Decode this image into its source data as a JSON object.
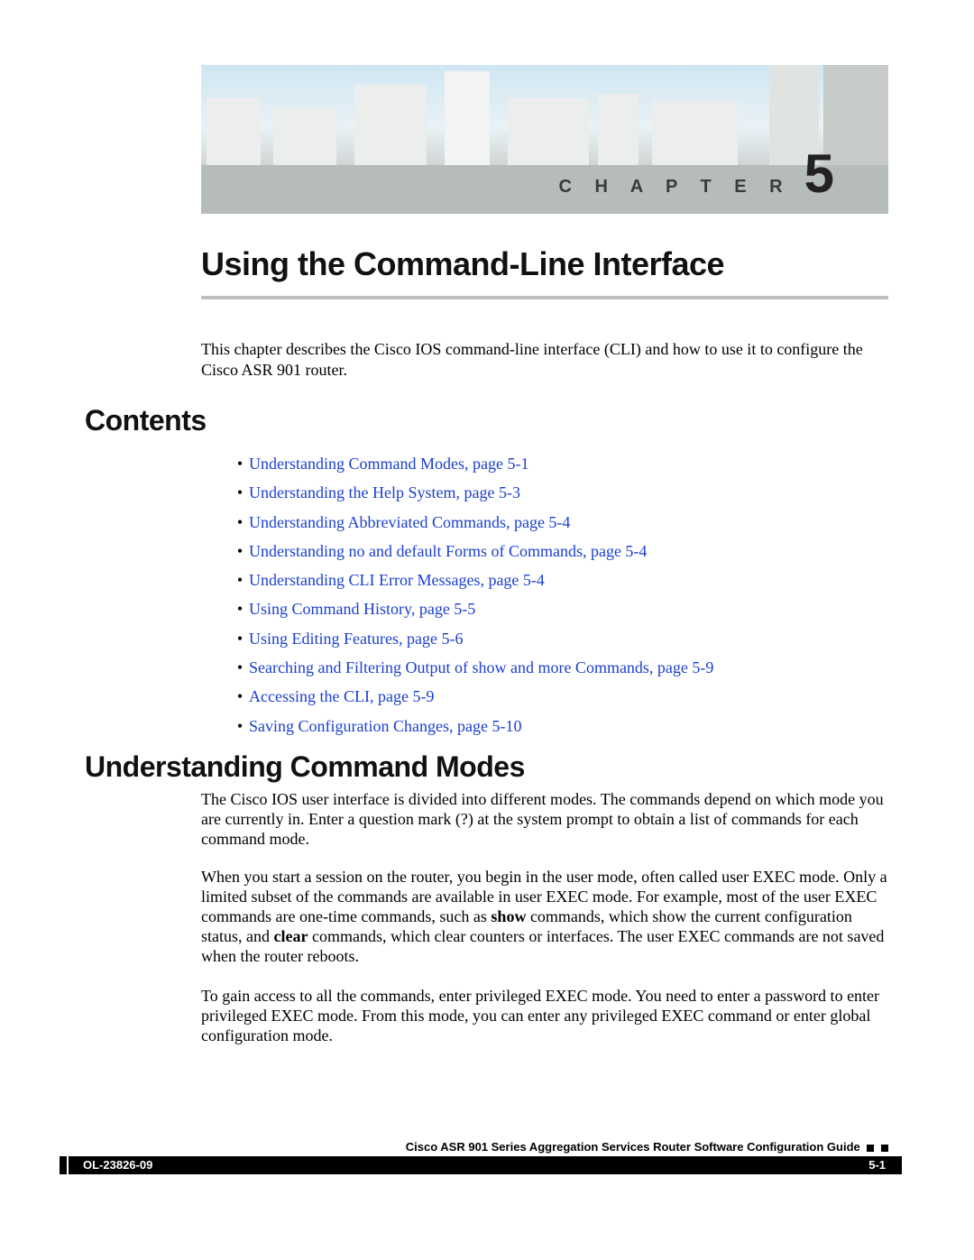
{
  "chapter": {
    "label": "C H A P T E R",
    "number": "5"
  },
  "title": "Using the Command-Line Interface",
  "intro": "This chapter describes the Cisco IOS command-line interface (CLI) and how to use it to configure the Cisco ASR 901 router.",
  "contents_heading": "Contents",
  "toc": [
    "Understanding Command Modes, page 5-1",
    "Understanding the Help System, page 5-3",
    "Understanding Abbreviated Commands, page 5-4",
    "Understanding no and default Forms of Commands, page 5-4",
    "Understanding CLI Error Messages, page 5-4",
    "Using Command History, page 5-5",
    "Using Editing Features, page 5-6",
    "Searching and Filtering Output of show and more Commands, page 5-9",
    "Accessing the CLI, page 5-9",
    "Saving Configuration Changes, page 5-10"
  ],
  "section_heading": "Understanding Command Modes",
  "p1": "The Cisco IOS user interface is divided into different modes. The commands depend on which mode you are currently in. Enter a question mark (?) at the system prompt to obtain a list of commands for each command mode.",
  "p2_a": "When you start a session on the router, you begin in the user mode, often called user EXEC mode. Only a limited subset of the commands are available in user EXEC mode. For example, most of the user EXEC commands are one-time commands, such as ",
  "p2_show": "show",
  "p2_b": " commands, which show the current configuration status, and ",
  "p2_clear": "clear",
  "p2_c": " commands, which clear counters or interfaces. The user EXEC commands are not saved when the router reboots.",
  "p3": "To gain access to all the commands, enter privileged EXEC mode. You need to enter a password to enter privileged EXEC mode. From this mode, you can enter any privileged EXEC command or enter global configuration mode.",
  "footer": {
    "guide": "Cisco ASR 901 Series Aggregation Services Router Software Configuration Guide",
    "doc_id": "OL-23826-09",
    "page": "5-1"
  }
}
